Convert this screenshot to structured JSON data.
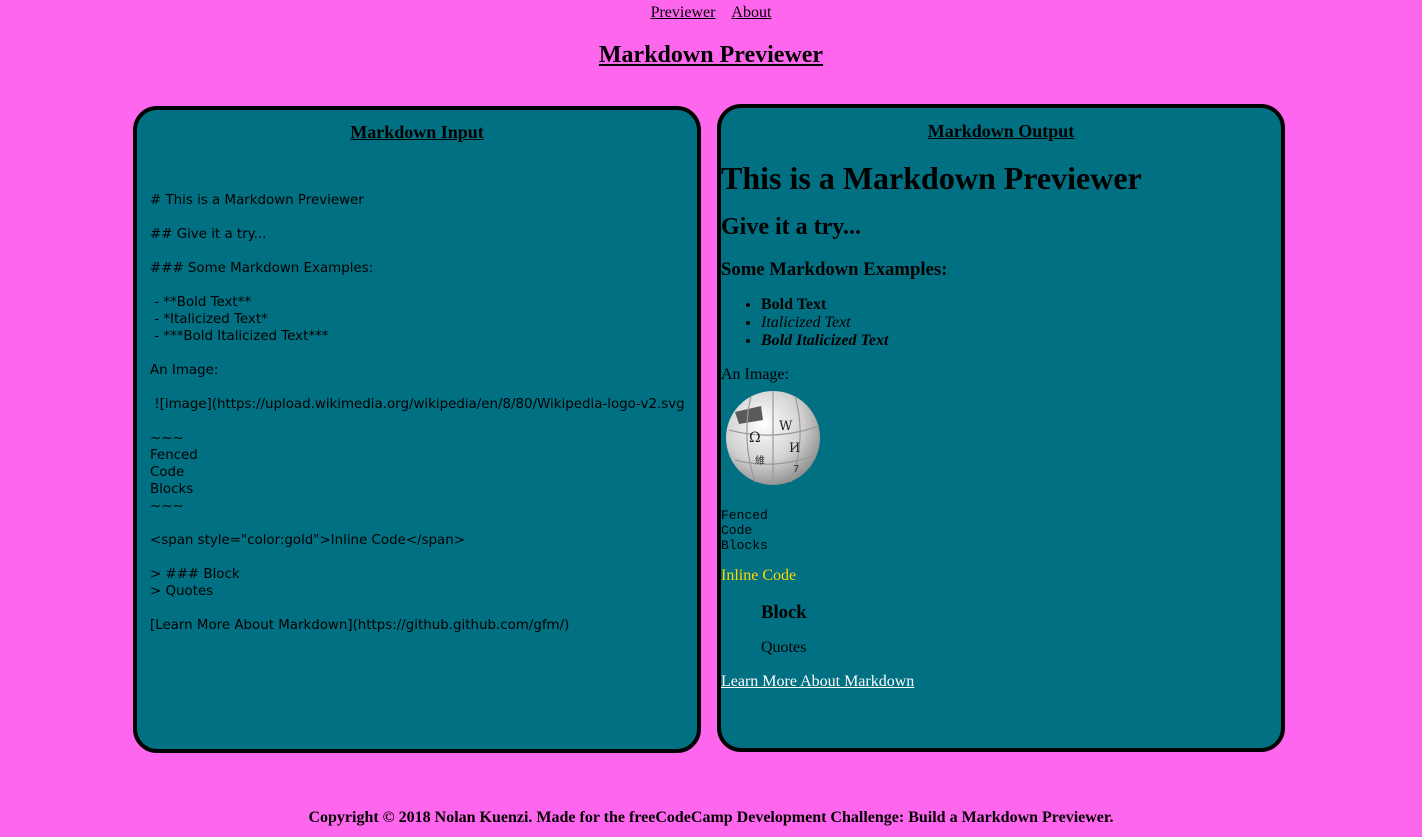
{
  "nav": {
    "items": [
      "Previewer",
      "About"
    ]
  },
  "page_title": "Markdown Previewer",
  "input_panel": {
    "title": "Markdown Input",
    "text": "# This is a Markdown Previewer\n\n## Give it a try...\n\n### Some Markdown Examples:\n\n - **Bold Text**\n - *Italicized Text*\n - ***Bold Italicized Text***\n\nAn Image:\n\n ![image](https://upload.wikimedia.org/wikipedia/en/8/80/Wikipedia-logo-v2.svg)\n\n~~~\nFenced\nCode\nBlocks\n~~~\n\n<span style=\"color:gold\">Inline Code</span>\n\n> ### Block\n> Quotes\n\n[Learn More About Markdown](https://github.github.com/gfm/)"
  },
  "output_panel": {
    "title": "Markdown Output",
    "h1": "This is a Markdown Previewer",
    "h2": "Give it a try...",
    "h3": "Some Markdown Examples:",
    "list": [
      "Bold Text",
      "Italicized Text",
      "Bold Italicized Text"
    ],
    "image_label": "An Image:",
    "image_icon": "wikipedia-globe-icon",
    "code_block": "Fenced\nCode\nBlocks",
    "inline_code": "Inline Code",
    "inline_code_color": "#ffd700",
    "quote_heading": "Block",
    "quote_text": "Quotes",
    "link_text": "Learn More About Markdown"
  },
  "footer": "Copyright © 2018 Nolan Kuenzi. Made for the freeCodeCamp Development Challenge: Build a Markdown Previewer.",
  "colors": {
    "background": "#ff66ee",
    "panel": "#007082",
    "link": "#ffffff"
  }
}
